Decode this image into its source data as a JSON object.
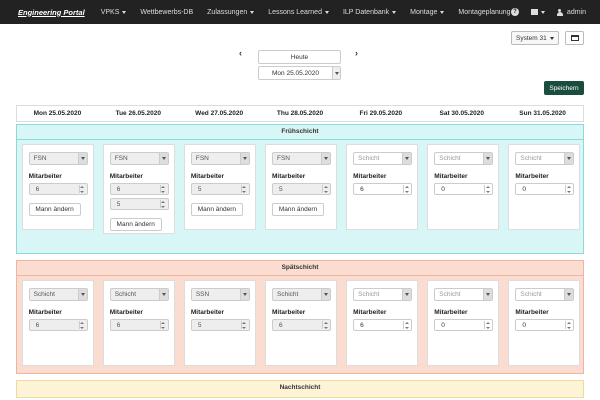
{
  "navbar": {
    "brand": "Engineering Portal",
    "items": [
      {
        "label": "VPKS",
        "dropdown": true
      },
      {
        "label": "Wettbewerbs-DB",
        "dropdown": false
      },
      {
        "label": "Zulassungen",
        "dropdown": true
      },
      {
        "label": "Lessons Learned",
        "dropdown": true
      },
      {
        "label": "ILP Datenbank",
        "dropdown": true
      },
      {
        "label": "Montage",
        "dropdown": true
      },
      {
        "label": "Montageplanung",
        "dropdown": false
      }
    ],
    "help_icon": "?",
    "user": "admin"
  },
  "controls": {
    "system": "System 31",
    "today": "Heute",
    "date": "Mon 25.05.2020",
    "prev": "‹",
    "next": "›",
    "save": "Speichern"
  },
  "days": [
    "Mon 25.05.2020",
    "Tue 26.05.2020",
    "Wed 27.05.2020",
    "Thu 28.05.2020",
    "Fri 29.05.2020",
    "Sat 30.05.2020",
    "Sun 31.05.2020"
  ],
  "labels": {
    "mitarbeiter": "Mitarbeiter",
    "mann_aendern": "Mann ändern"
  },
  "shifts": [
    {
      "name": "Frühschicht",
      "bg": "#d8f6f6",
      "border": "#8fd8d8",
      "cells": [
        {
          "team": "FSN",
          "disabled": true,
          "values": [
            "6"
          ],
          "button": true
        },
        {
          "team": "FSN",
          "disabled": true,
          "values": [
            "6",
            "5"
          ],
          "button": true
        },
        {
          "team": "FSN",
          "disabled": true,
          "values": [
            "5"
          ],
          "button": true
        },
        {
          "team": "FSN",
          "disabled": true,
          "values": [
            "5"
          ],
          "button": true
        },
        {
          "team": "Schicht",
          "disabled": false,
          "values": [
            "6"
          ],
          "button": false
        },
        {
          "team": "Schicht",
          "disabled": false,
          "values": [
            "0"
          ],
          "button": false
        },
        {
          "team": "Schicht",
          "disabled": false,
          "values": [
            "0"
          ],
          "button": false
        }
      ]
    },
    {
      "name": "Spätschicht",
      "bg": "#fbdcd0",
      "border": "#f0b5a0",
      "cells": [
        {
          "team": "Schicht",
          "disabled": true,
          "values": [
            "6"
          ],
          "button": false
        },
        {
          "team": "Schicht",
          "disabled": true,
          "values": [
            "6"
          ],
          "button": false
        },
        {
          "team": "SSN",
          "disabled": true,
          "values": [
            "5"
          ],
          "button": false
        },
        {
          "team": "Schicht",
          "disabled": true,
          "values": [
            "6"
          ],
          "button": false
        },
        {
          "team": "Schicht",
          "disabled": false,
          "values": [
            "6"
          ],
          "button": false
        },
        {
          "team": "Schicht",
          "disabled": false,
          "values": [
            "0"
          ],
          "button": false
        },
        {
          "team": "Schicht",
          "disabled": false,
          "values": [
            "0"
          ],
          "button": false
        }
      ]
    },
    {
      "name": "Nachtschicht",
      "bg": "#fdf3d7",
      "border": "#f0d99a",
      "cells": []
    }
  ]
}
